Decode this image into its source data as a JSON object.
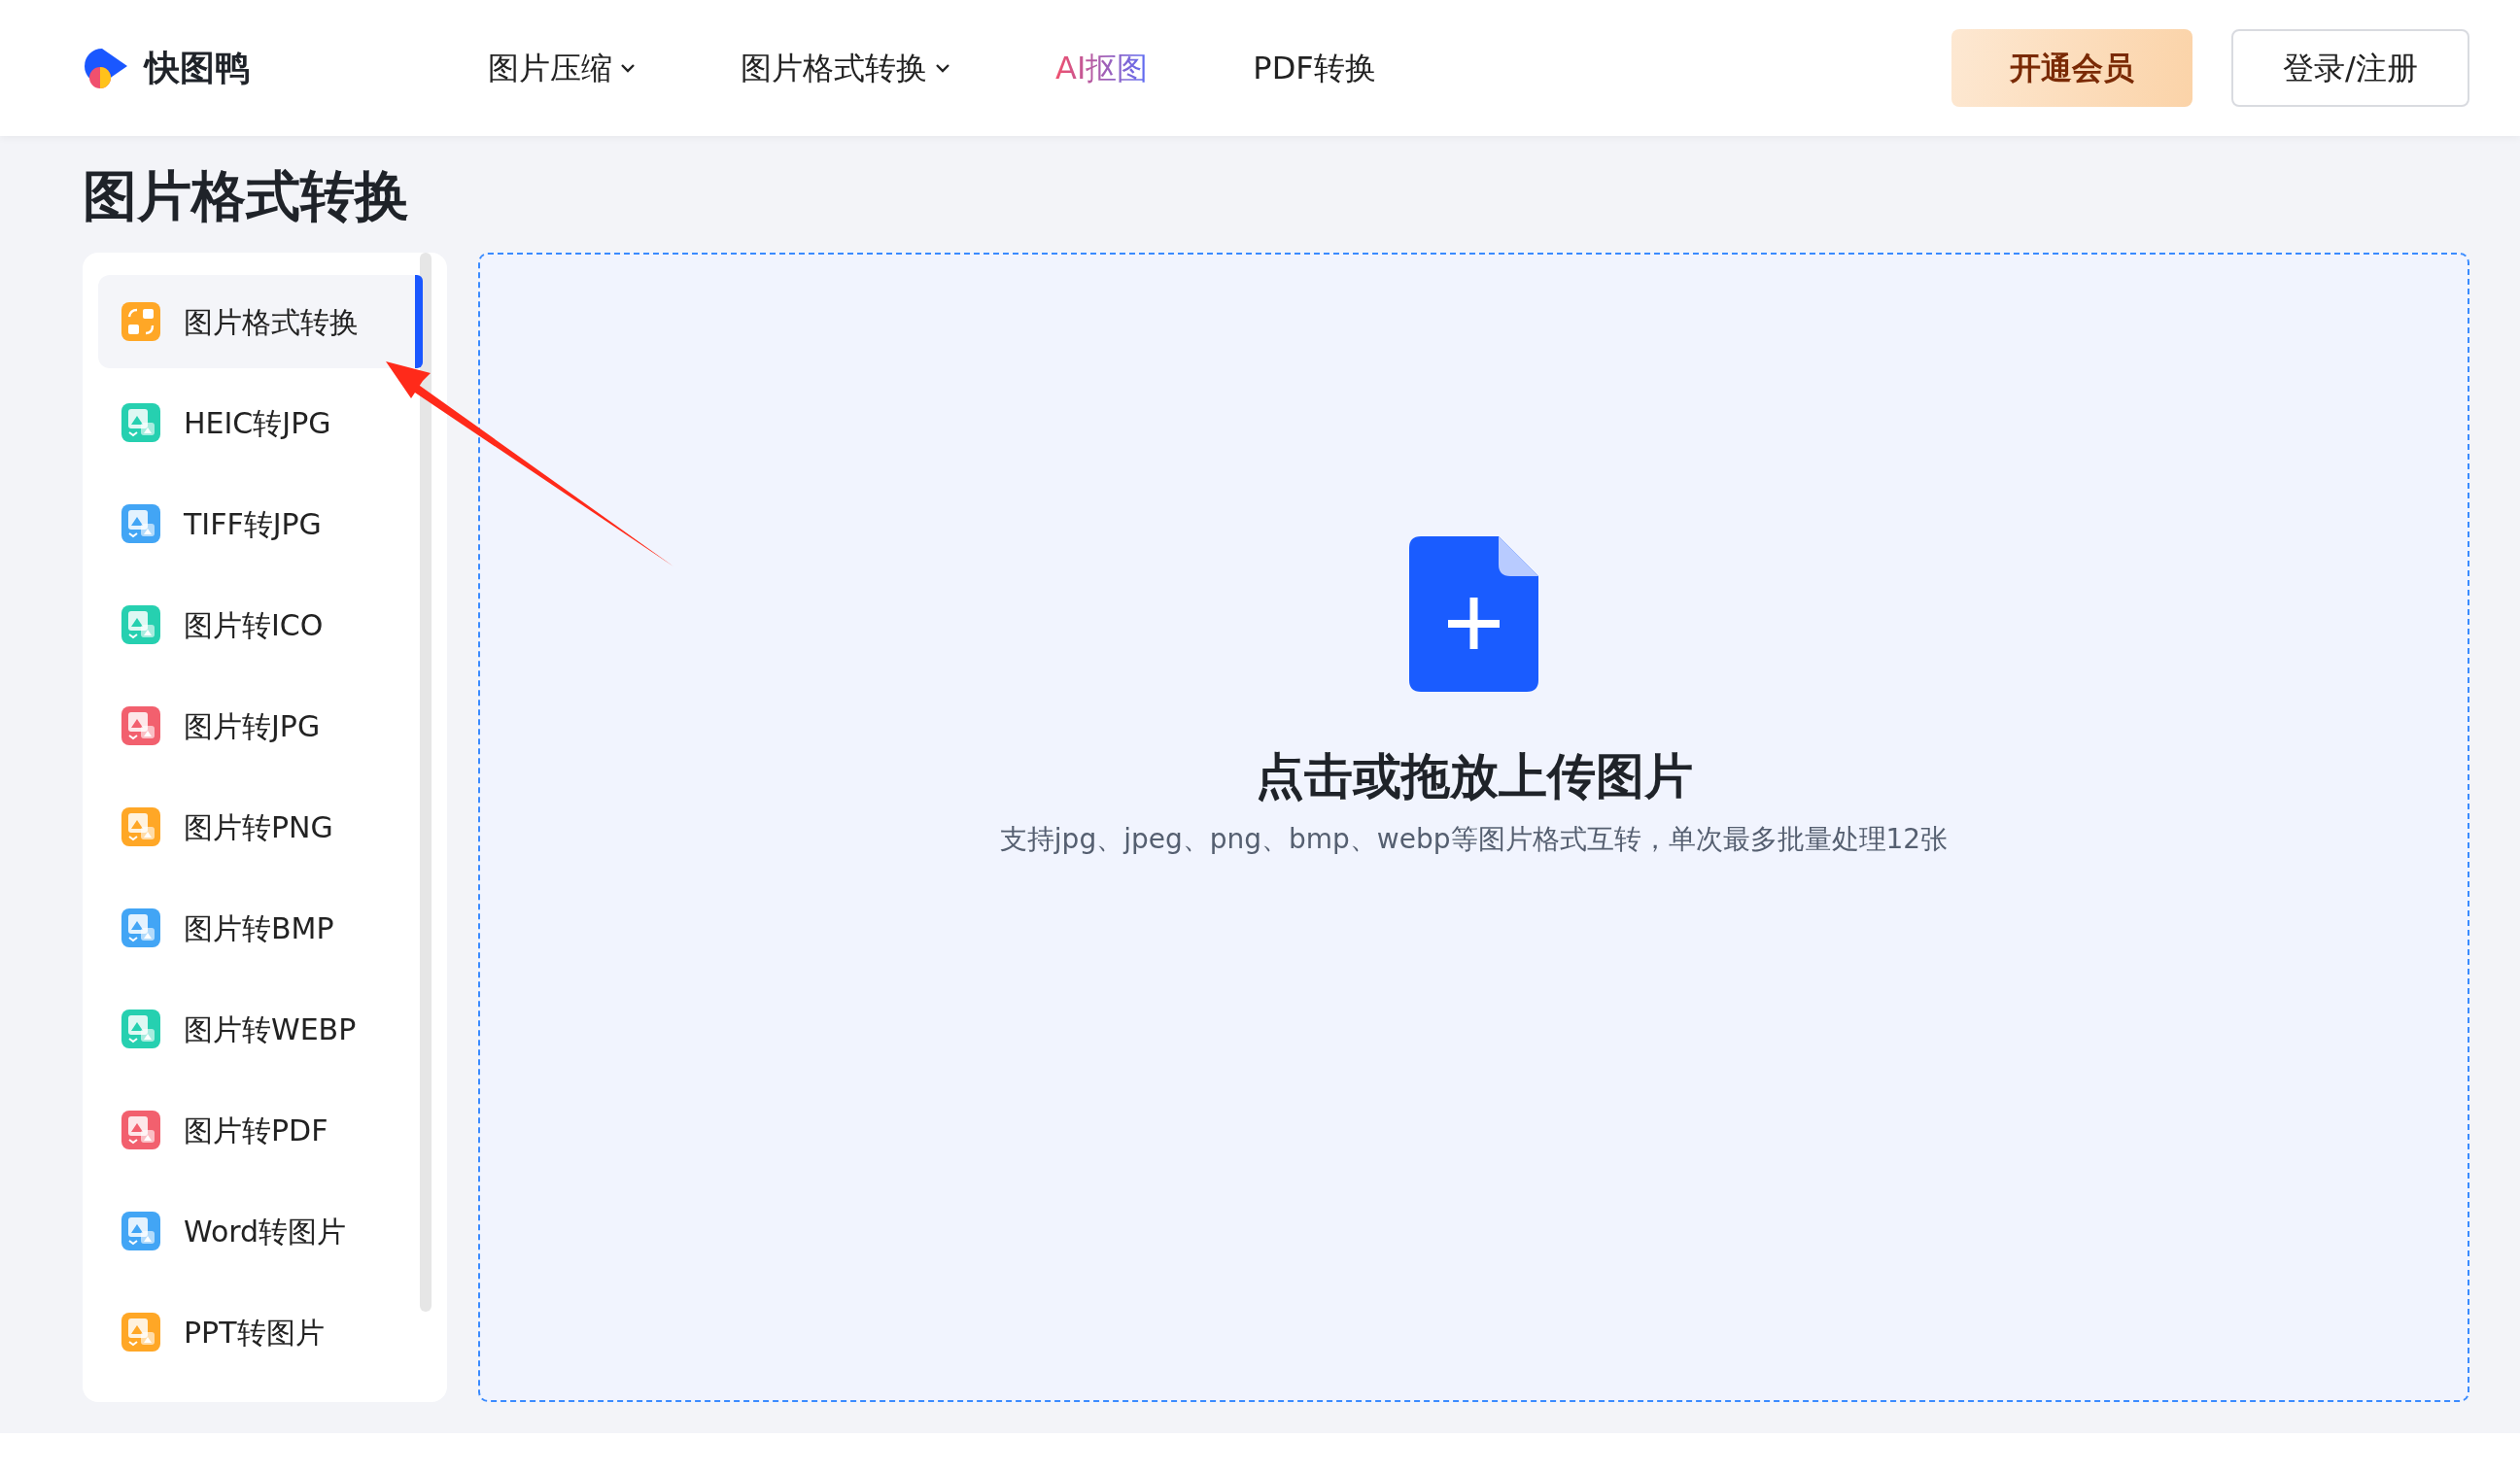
{
  "brand": {
    "name": "快图鸭"
  },
  "nav": [
    {
      "label": "图片压缩",
      "dropdown": true,
      "highlighted": false
    },
    {
      "label": "图片格式转换",
      "dropdown": true,
      "highlighted": false
    },
    {
      "label": "AI抠图",
      "dropdown": false,
      "highlighted": true
    },
    {
      "label": "PDF转换",
      "dropdown": false,
      "highlighted": false
    }
  ],
  "header_buttons": [
    {
      "label": "开通会员",
      "kind": "vip"
    },
    {
      "label": "登录/注册",
      "kind": "outline"
    }
  ],
  "page_title": "图片格式转换",
  "sidebar": {
    "items": [
      {
        "label": "图片格式转换",
        "selected": true,
        "color": "#ffa726",
        "kind": "swap"
      },
      {
        "label": "HEIC转JPG",
        "selected": false,
        "color": "#26d0b0",
        "kind": "image"
      },
      {
        "label": "TIFF转JPG",
        "selected": false,
        "color": "#42a5f5",
        "kind": "image"
      },
      {
        "label": "图片转ICO",
        "selected": false,
        "color": "#26d0b0",
        "kind": "image"
      },
      {
        "label": "图片转JPG",
        "selected": false,
        "color": "#f2606e",
        "kind": "image"
      },
      {
        "label": "图片转PNG",
        "selected": false,
        "color": "#ffa726",
        "kind": "image"
      },
      {
        "label": "图片转BMP",
        "selected": false,
        "color": "#42a5f5",
        "kind": "image"
      },
      {
        "label": "图片转WEBP",
        "selected": false,
        "color": "#26d0b0",
        "kind": "image"
      },
      {
        "label": "图片转PDF",
        "selected": false,
        "color": "#f2606e",
        "kind": "image"
      },
      {
        "label": "Word转图片",
        "selected": false,
        "color": "#42a5f5",
        "kind": "image"
      },
      {
        "label": "PPT转图片",
        "selected": false,
        "color": "#ffa726",
        "kind": "image"
      }
    ]
  },
  "upload": {
    "title": "点击或拖放上传图片",
    "hint": "支持jpg、jpeg、png、bmp、webp等图片格式互转，单次最多批量处理12张"
  }
}
